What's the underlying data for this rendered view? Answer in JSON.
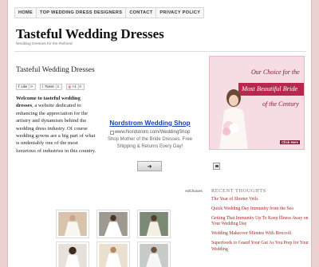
{
  "nav": [
    "HOME",
    "TOP WEDDING DRESS DESIGNERS",
    "CONTACT",
    "PRIVACY POLICY"
  ],
  "site": {
    "title": "Tasteful Wedding Dresses",
    "tagline": "Wedding Dresses for the Refined"
  },
  "post": {
    "title": "Tasteful Wedding Dresses",
    "intro_bold": "Welcome to tasteful wedding dresses",
    "intro_rest": ", a website dedicated to enhancing the appreciation for the artistry and dynamism behind the wedding dress industry. Of course wedding gowns are a big part of what is undeniably one of the most luxurious of industries in this country."
  },
  "share": {
    "like_label": "Like",
    "like_count": "0",
    "tweet_label": "Tweet",
    "tweet_count": "2",
    "plus_label": "+1",
    "plus_count": "0"
  },
  "ad": {
    "title": "Nordstrom Wedding Shop",
    "url": "www.Nordstrom.com/WeddingShop",
    "text": "Shop Mother of the Bride Dresses. Free Shipping & Returns Every Day!",
    "adchoices": "AdChoices"
  },
  "banner": {
    "line1": "Our Choice for the",
    "line2": "Most Beautiful Bride",
    "line3": "of the Century",
    "click": "Click Here"
  },
  "recent": {
    "heading": "Recent Thoughts",
    "items": [
      "The Year of Shorter Veils",
      "Quick Wedding Day Immunity from the Sea",
      "Getting That Immunity Up To Keep Illness Away on Your Wedding Day",
      "Wedding Makeover Minutes With Broccoli",
      "Superfoods to Guard Your Gut As You Prep for Your Wedding"
    ]
  },
  "colors": {
    "background": "#ecd1d1",
    "link": "#a82524",
    "ad_title": "#1a3fb5",
    "banner_accent": "#b8284c"
  }
}
